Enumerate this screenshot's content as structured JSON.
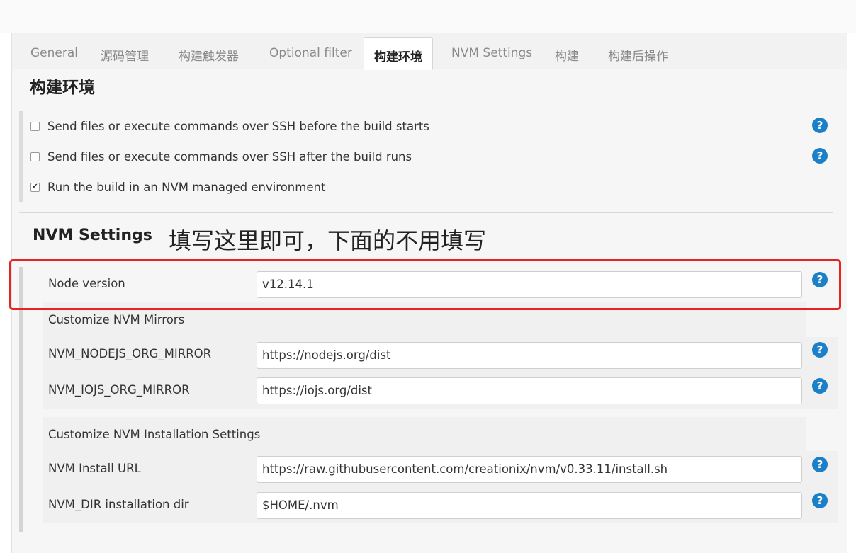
{
  "tabs": [
    {
      "label": "General"
    },
    {
      "label": "源码管理"
    },
    {
      "label": "构建触发器"
    },
    {
      "label": "Optional filter"
    },
    {
      "label": "构建环境"
    },
    {
      "label": "NVM Settings"
    },
    {
      "label": "构建"
    },
    {
      "label": "构建后操作"
    }
  ],
  "active_tab": "构建环境",
  "section_title": "构建环境",
  "options": [
    {
      "label": "Send files or execute commands over SSH before the build starts",
      "checked": false
    },
    {
      "label": "Send files or execute commands over SSH after the build runs",
      "checked": false
    },
    {
      "label": "Run the build in an NVM managed environment",
      "checked": true
    }
  ],
  "nvm": {
    "heading": "NVM Settings",
    "annotation": "填写这里即可，下面的不用填写",
    "node_version_label": "Node version",
    "node_version_value": "v12.14.1",
    "mirrors_title": "Customize NVM Mirrors",
    "nodejs_mirror_label": "NVM_NODEJS_ORG_MIRROR",
    "nodejs_mirror_value": "https://nodejs.org/dist",
    "iojs_mirror_label": "NVM_IOJS_ORG_MIRROR",
    "iojs_mirror_value": "https://iojs.org/dist",
    "install_title": "Customize NVM Installation Settings",
    "install_url_label": "NVM Install URL",
    "install_url_value": "https://raw.githubusercontent.com/creationix/nvm/v0.33.11/install.sh",
    "dir_label": "NVM_DIR installation dir",
    "dir_value": "$HOME/.nvm"
  },
  "help_icon": "question-mark-icon",
  "colors": {
    "help": "#1c80c8",
    "highlight": "#e8231f"
  }
}
